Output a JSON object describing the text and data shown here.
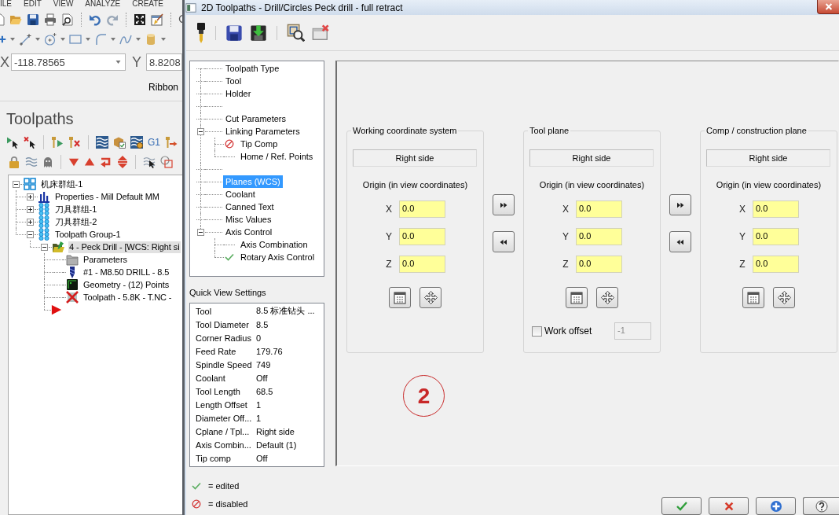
{
  "app_menu": [
    "ILE",
    "EDIT",
    "VIEW",
    "ANALYZE",
    "CREATE"
  ],
  "coordinates": [
    {
      "axis": "X",
      "value": "-118.78565",
      "dropdown": true
    },
    {
      "axis": "Y",
      "value": "8.8208",
      "dropdown": false
    }
  ],
  "ribbon_label": "Ribbon",
  "toolpaths_panel": {
    "title": "Toolpaths",
    "text_button": "G1",
    "tree": [
      {
        "kind": "machine_group",
        "label": "机床群组-1",
        "expanded": true,
        "selected": false,
        "children": [
          {
            "kind": "properties",
            "label": "Properties - Mill Default MM",
            "expanded": false,
            "selected": false
          },
          {
            "kind": "group",
            "label": "刀具群组-1",
            "expanded": false,
            "selected": false
          },
          {
            "kind": "group",
            "label": "刀具群组-2",
            "expanded": false,
            "selected": false
          },
          {
            "kind": "group",
            "label": "Toolpath Group-1",
            "expanded": true,
            "selected": false,
            "children": [
              {
                "kind": "operation",
                "label": "4 - Peck Drill - [WCS: Right si",
                "expanded": true,
                "selected": true,
                "children": [
                  {
                    "kind": "parameters",
                    "label": "Parameters",
                    "selected": false
                  },
                  {
                    "kind": "tool",
                    "label": "#1 - M8.50 DRILL - 8.5",
                    "selected": false
                  },
                  {
                    "kind": "geometry",
                    "label": "Geometry - (12) Points",
                    "selected": false
                  },
                  {
                    "kind": "toolpath",
                    "label": "Toolpath - 5.8K - T.NC -",
                    "selected": false
                  },
                  {
                    "kind": "insert_marker"
                  }
                ]
              }
            ]
          }
        ]
      }
    ]
  },
  "dialog": {
    "title": "2D Toolpaths - Drill/Circles Peck drill - full retract",
    "tree": [
      {
        "kind": "item",
        "label": "Toolpath Type",
        "selected": false
      },
      {
        "kind": "item",
        "label": "Tool",
        "selected": false
      },
      {
        "kind": "item",
        "label": "Holder",
        "selected": false
      },
      {
        "kind": "spacer"
      },
      {
        "kind": "item",
        "label": "Cut Parameters",
        "selected": false
      },
      {
        "kind": "item",
        "label": "Linking Parameters",
        "selected": false,
        "expanded": true,
        "children": [
          {
            "kind": "item",
            "label": "Tip Comp",
            "selected": false,
            "disabled": true
          },
          {
            "kind": "item",
            "label": "Home / Ref. Points",
            "selected": false
          }
        ]
      },
      {
        "kind": "spacer"
      },
      {
        "kind": "item",
        "label": "Planes (WCS)",
        "selected": true
      },
      {
        "kind": "item",
        "label": "Coolant",
        "selected": false
      },
      {
        "kind": "item",
        "label": "Canned Text",
        "selected": false
      },
      {
        "kind": "item",
        "label": "Misc Values",
        "selected": false
      },
      {
        "kind": "item",
        "label": "Axis Control",
        "selected": false,
        "expanded": true,
        "children": [
          {
            "kind": "item",
            "label": "Axis Combination",
            "selected": false
          },
          {
            "kind": "item",
            "label": "Rotary Axis Control",
            "selected": false,
            "edited": true
          }
        ]
      }
    ],
    "quick_view": {
      "title": "Quick View Settings",
      "rows": [
        {
          "label": "Tool",
          "value": "8.5 标准钻头 ..."
        },
        {
          "label": "Tool Diameter",
          "value": "8.5"
        },
        {
          "label": "Corner Radius",
          "value": "0"
        },
        {
          "label": "Feed Rate",
          "value": "179.76"
        },
        {
          "label": "Spindle Speed",
          "value": "749"
        },
        {
          "label": "Coolant",
          "value": "Off"
        },
        {
          "label": "Tool Length",
          "value": "68.5"
        },
        {
          "label": "Length Offset",
          "value": "1"
        },
        {
          "label": "Diameter Off...",
          "value": "1"
        },
        {
          "label": "Cplane / Tpl...",
          "value": "Right side"
        },
        {
          "label": "Axis Combin...",
          "value": "Default (1)"
        },
        {
          "label": "Tip comp",
          "value": "Off"
        }
      ]
    },
    "legend": [
      {
        "kind": "edited",
        "text": "= edited"
      },
      {
        "kind": "disabled",
        "text": "= disabled"
      }
    ],
    "planes": [
      {
        "title": "Working coordinate system",
        "view": "Right side",
        "origin_label": "Origin (in view coordinates)",
        "origin": [
          {
            "axis": "X",
            "value": "0.0"
          },
          {
            "axis": "Y",
            "value": "0.0"
          },
          {
            "axis": "Z",
            "value": "0.0"
          }
        ]
      },
      {
        "title": "Tool plane",
        "view": "Right side",
        "origin_label": "Origin (in view coordinates)",
        "origin": [
          {
            "axis": "X",
            "value": "0.0"
          },
          {
            "axis": "Y",
            "value": "0.0"
          },
          {
            "axis": "Z",
            "value": "0.0"
          }
        ],
        "work_offset": {
          "label": "Work offset",
          "checked": false,
          "value": "-1",
          "disabled": true
        }
      },
      {
        "title": "Comp / construction plane",
        "view": "Right side",
        "origin_label": "Origin (in view coordinates)",
        "origin": [
          {
            "axis": "X",
            "value": "0.0"
          },
          {
            "axis": "Y",
            "value": "0.0"
          },
          {
            "axis": "Z",
            "value": "0.0"
          }
        ]
      }
    ],
    "annotation": "2"
  }
}
